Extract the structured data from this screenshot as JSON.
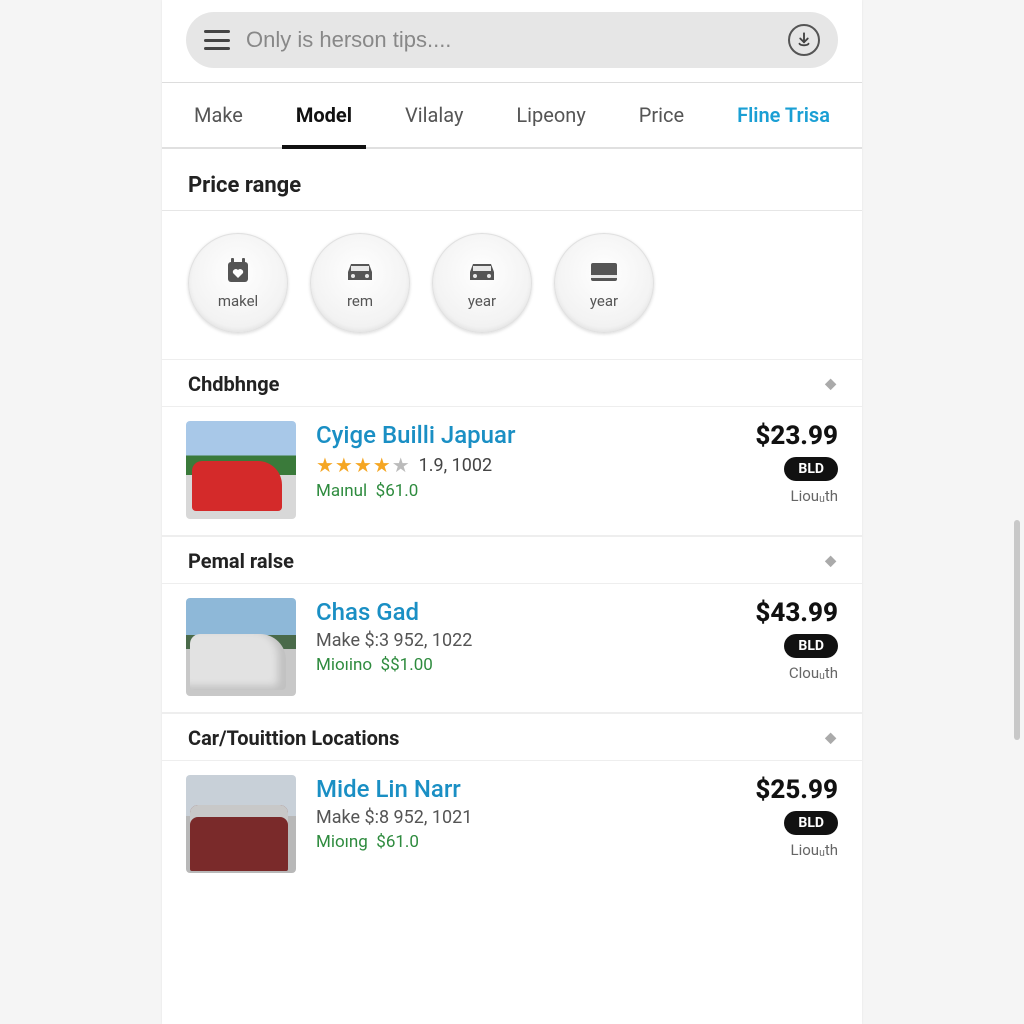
{
  "search": {
    "placeholder": "Only is herson tips...."
  },
  "tabs": [
    {
      "label": "Make",
      "active": false
    },
    {
      "label": "Model",
      "active": true
    },
    {
      "label": "Vilalay",
      "active": false
    },
    {
      "label": "Lipeony",
      "active": false
    },
    {
      "label": "Price",
      "active": false
    },
    {
      "label": "Fline Trisa",
      "accent": true
    }
  ],
  "price_range_title": "Price range",
  "chips": [
    {
      "label": "makel",
      "icon": "heart-tag-icon"
    },
    {
      "label": "rem",
      "icon": "car-front-icon"
    },
    {
      "label": "year",
      "icon": "car-front-icon"
    },
    {
      "label": "year",
      "icon": "card-icon"
    }
  ],
  "groups": [
    {
      "header": "Chdbhnge",
      "item": {
        "title": "Cyige Builli Japuar",
        "rating_text": "1.9, 1002",
        "stars_full": 4,
        "sub_label": "Maınul",
        "sub_value": "$61.0",
        "price": "$23.99",
        "badge": "BLD",
        "small": "Liouᵤth",
        "thumb": "red"
      }
    },
    {
      "header": "Pemal ralse",
      "item": {
        "title": "Chas Gad",
        "meta": "Make $:3 952, 1022",
        "sub_label": "Mioıino",
        "sub_value": "$$1.00",
        "price": "$43.99",
        "badge": "BLD",
        "small": "Clouᵤth",
        "thumb": "silver"
      }
    },
    {
      "header": "Car/Touittion Locations",
      "item": {
        "title": "Mide Lin Narr",
        "meta": "Make $:8 952, 1021",
        "sub_label": "Mioıng",
        "sub_value": "$61.0",
        "price": "$25.99",
        "badge": "BLD",
        "small": "Liouᵤth",
        "thumb": "maroon"
      }
    }
  ]
}
